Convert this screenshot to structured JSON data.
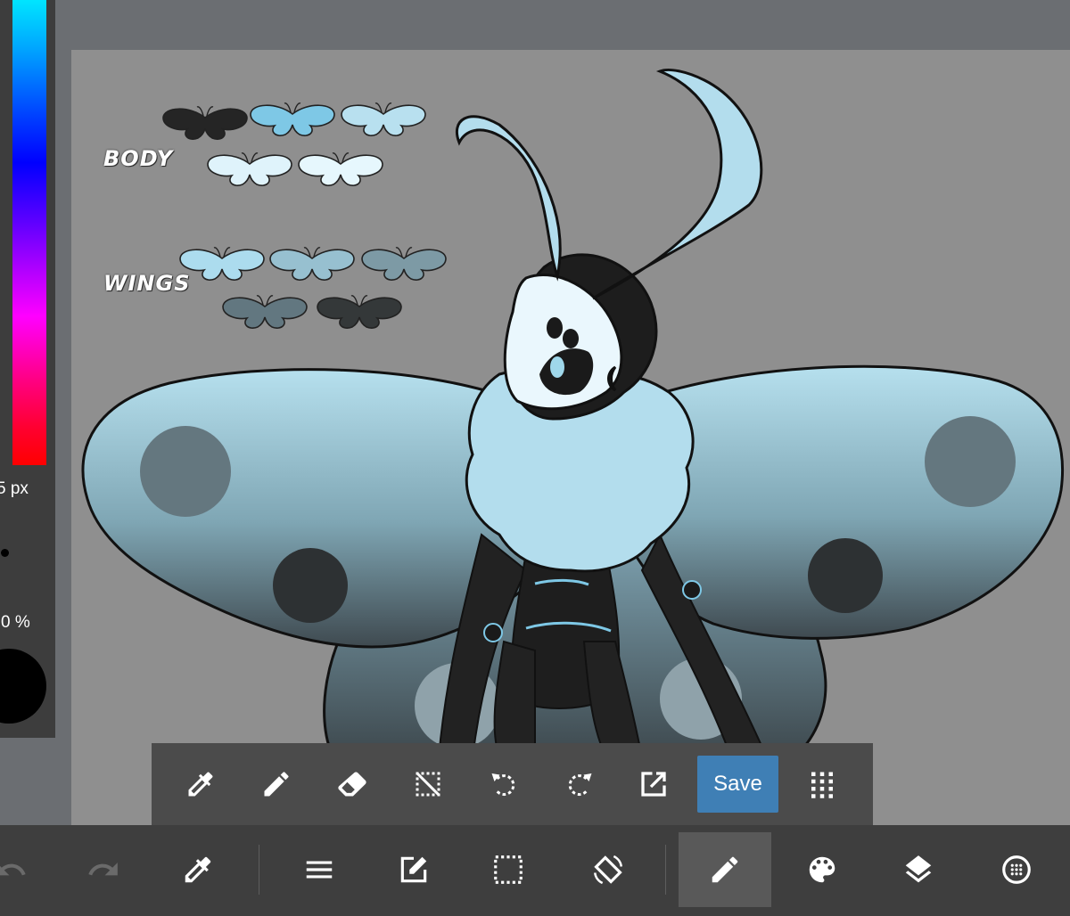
{
  "side_panel": {
    "brush_size": "5 px",
    "opacity": "0 %",
    "color": "#000000"
  },
  "canvas": {
    "labels": {
      "body": "BODY",
      "wings": "WINGS"
    },
    "body_palette": [
      "#252525",
      "#7ec8e6",
      "#b8e0ef",
      "#dff3fb",
      "#e6f7fd"
    ],
    "wing_palette": [
      "#acdcee",
      "#97c0d0",
      "#7d9aa5",
      "#627780",
      "#343839"
    ]
  },
  "toolbar": {
    "tools": [
      "eyedropper-icon",
      "pencil-icon",
      "eraser-icon",
      "deselect-icon",
      "undo-icon",
      "redo-icon",
      "export-icon"
    ],
    "save_label": "Save",
    "more": "grid-menu-icon"
  },
  "bottom_bar": {
    "items": [
      "undo-icon",
      "redo-icon",
      "eyedropper-icon",
      "menu-icon",
      "edit-icon",
      "selection-icon",
      "rotate-screen-icon",
      "brush-icon",
      "palette-icon",
      "layers-icon",
      "material-icon"
    ],
    "active": "brush-icon"
  }
}
